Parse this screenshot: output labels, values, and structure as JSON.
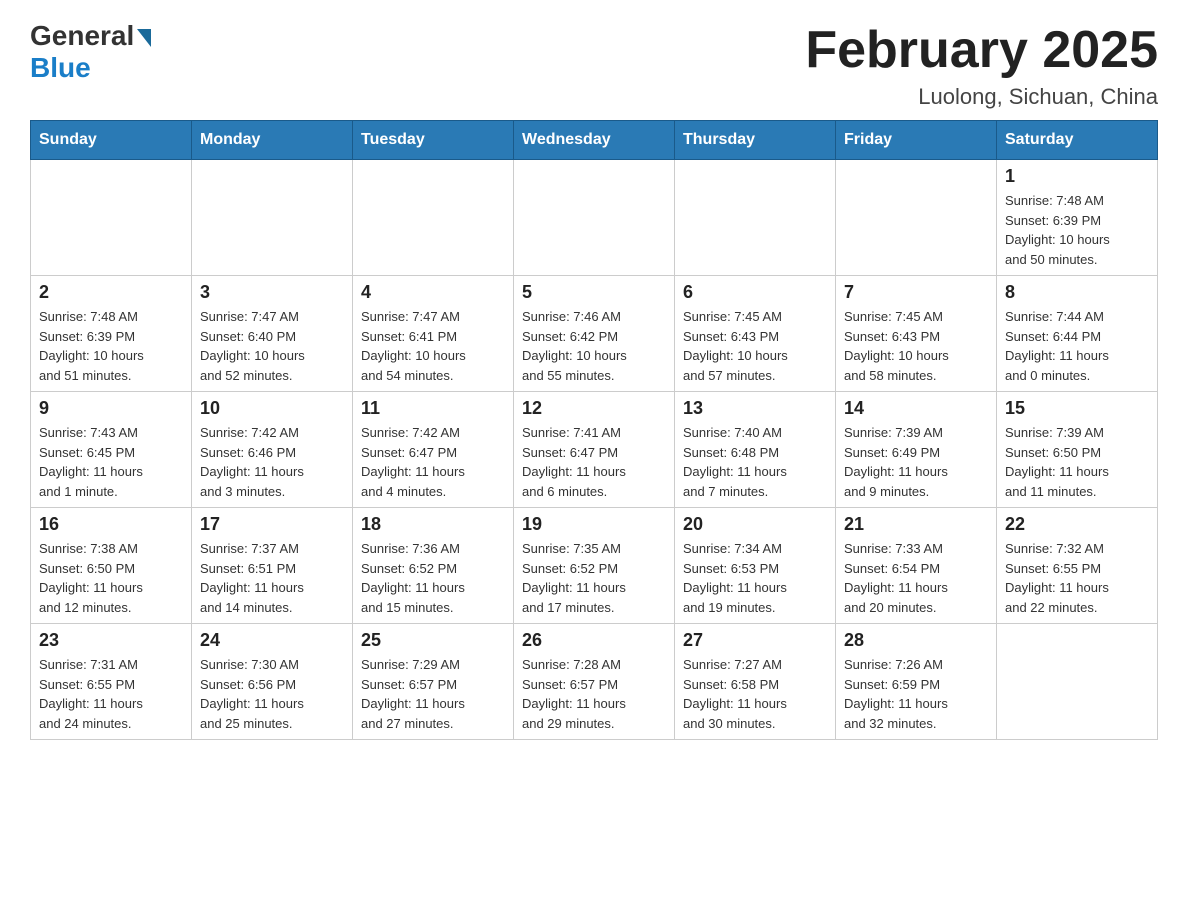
{
  "logo": {
    "general": "General",
    "blue": "Blue"
  },
  "header": {
    "title": "February 2025",
    "subtitle": "Luolong, Sichuan, China"
  },
  "days": [
    "Sunday",
    "Monday",
    "Tuesday",
    "Wednesday",
    "Thursday",
    "Friday",
    "Saturday"
  ],
  "weeks": [
    [
      {
        "num": "",
        "info": ""
      },
      {
        "num": "",
        "info": ""
      },
      {
        "num": "",
        "info": ""
      },
      {
        "num": "",
        "info": ""
      },
      {
        "num": "",
        "info": ""
      },
      {
        "num": "",
        "info": ""
      },
      {
        "num": "1",
        "info": "Sunrise: 7:48 AM\nSunset: 6:39 PM\nDaylight: 10 hours\nand 50 minutes."
      }
    ],
    [
      {
        "num": "2",
        "info": "Sunrise: 7:48 AM\nSunset: 6:39 PM\nDaylight: 10 hours\nand 51 minutes."
      },
      {
        "num": "3",
        "info": "Sunrise: 7:47 AM\nSunset: 6:40 PM\nDaylight: 10 hours\nand 52 minutes."
      },
      {
        "num": "4",
        "info": "Sunrise: 7:47 AM\nSunset: 6:41 PM\nDaylight: 10 hours\nand 54 minutes."
      },
      {
        "num": "5",
        "info": "Sunrise: 7:46 AM\nSunset: 6:42 PM\nDaylight: 10 hours\nand 55 minutes."
      },
      {
        "num": "6",
        "info": "Sunrise: 7:45 AM\nSunset: 6:43 PM\nDaylight: 10 hours\nand 57 minutes."
      },
      {
        "num": "7",
        "info": "Sunrise: 7:45 AM\nSunset: 6:43 PM\nDaylight: 10 hours\nand 58 minutes."
      },
      {
        "num": "8",
        "info": "Sunrise: 7:44 AM\nSunset: 6:44 PM\nDaylight: 11 hours\nand 0 minutes."
      }
    ],
    [
      {
        "num": "9",
        "info": "Sunrise: 7:43 AM\nSunset: 6:45 PM\nDaylight: 11 hours\nand 1 minute."
      },
      {
        "num": "10",
        "info": "Sunrise: 7:42 AM\nSunset: 6:46 PM\nDaylight: 11 hours\nand 3 minutes."
      },
      {
        "num": "11",
        "info": "Sunrise: 7:42 AM\nSunset: 6:47 PM\nDaylight: 11 hours\nand 4 minutes."
      },
      {
        "num": "12",
        "info": "Sunrise: 7:41 AM\nSunset: 6:47 PM\nDaylight: 11 hours\nand 6 minutes."
      },
      {
        "num": "13",
        "info": "Sunrise: 7:40 AM\nSunset: 6:48 PM\nDaylight: 11 hours\nand 7 minutes."
      },
      {
        "num": "14",
        "info": "Sunrise: 7:39 AM\nSunset: 6:49 PM\nDaylight: 11 hours\nand 9 minutes."
      },
      {
        "num": "15",
        "info": "Sunrise: 7:39 AM\nSunset: 6:50 PM\nDaylight: 11 hours\nand 11 minutes."
      }
    ],
    [
      {
        "num": "16",
        "info": "Sunrise: 7:38 AM\nSunset: 6:50 PM\nDaylight: 11 hours\nand 12 minutes."
      },
      {
        "num": "17",
        "info": "Sunrise: 7:37 AM\nSunset: 6:51 PM\nDaylight: 11 hours\nand 14 minutes."
      },
      {
        "num": "18",
        "info": "Sunrise: 7:36 AM\nSunset: 6:52 PM\nDaylight: 11 hours\nand 15 minutes."
      },
      {
        "num": "19",
        "info": "Sunrise: 7:35 AM\nSunset: 6:52 PM\nDaylight: 11 hours\nand 17 minutes."
      },
      {
        "num": "20",
        "info": "Sunrise: 7:34 AM\nSunset: 6:53 PM\nDaylight: 11 hours\nand 19 minutes."
      },
      {
        "num": "21",
        "info": "Sunrise: 7:33 AM\nSunset: 6:54 PM\nDaylight: 11 hours\nand 20 minutes."
      },
      {
        "num": "22",
        "info": "Sunrise: 7:32 AM\nSunset: 6:55 PM\nDaylight: 11 hours\nand 22 minutes."
      }
    ],
    [
      {
        "num": "23",
        "info": "Sunrise: 7:31 AM\nSunset: 6:55 PM\nDaylight: 11 hours\nand 24 minutes."
      },
      {
        "num": "24",
        "info": "Sunrise: 7:30 AM\nSunset: 6:56 PM\nDaylight: 11 hours\nand 25 minutes."
      },
      {
        "num": "25",
        "info": "Sunrise: 7:29 AM\nSunset: 6:57 PM\nDaylight: 11 hours\nand 27 minutes."
      },
      {
        "num": "26",
        "info": "Sunrise: 7:28 AM\nSunset: 6:57 PM\nDaylight: 11 hours\nand 29 minutes."
      },
      {
        "num": "27",
        "info": "Sunrise: 7:27 AM\nSunset: 6:58 PM\nDaylight: 11 hours\nand 30 minutes."
      },
      {
        "num": "28",
        "info": "Sunrise: 7:26 AM\nSunset: 6:59 PM\nDaylight: 11 hours\nand 32 minutes."
      },
      {
        "num": "",
        "info": ""
      }
    ]
  ]
}
